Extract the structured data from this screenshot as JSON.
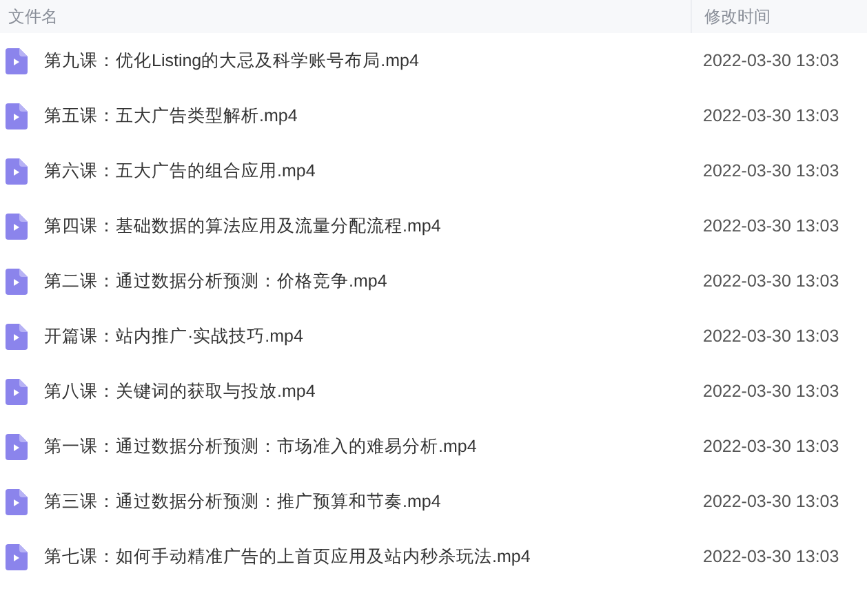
{
  "table": {
    "columns": [
      "文件名",
      "修改时间"
    ],
    "rows": [
      {
        "name": "第九课：优化Listing的大忌及科学账号布局.mp4",
        "modified": "2022-03-30 13:03"
      },
      {
        "name": "第五课：五大广告类型解析.mp4",
        "modified": "2022-03-30 13:03"
      },
      {
        "name": "第六课：五大广告的组合应用.mp4",
        "modified": "2022-03-30 13:03"
      },
      {
        "name": "第四课：基础数据的算法应用及流量分配流程.mp4",
        "modified": "2022-03-30 13:03"
      },
      {
        "name": "第二课：通过数据分析预测：价格竞争.mp4",
        "modified": "2022-03-30 13:03"
      },
      {
        "name": "开篇课：站内推广·实战技巧.mp4",
        "modified": "2022-03-30 13:03"
      },
      {
        "name": "第八课：关键词的获取与投放.mp4",
        "modified": "2022-03-30 13:03"
      },
      {
        "name": "第一课：通过数据分析预测：市场准入的难易分析.mp4",
        "modified": "2022-03-30 13:03"
      },
      {
        "name": "第三课：通过数据分析预测：推广预算和节奏.mp4",
        "modified": "2022-03-30 13:03"
      },
      {
        "name": "第七课：如何手动精准广告的上首页应用及站内秒杀玩法.mp4",
        "modified": "2022-03-30 13:03"
      }
    ]
  }
}
